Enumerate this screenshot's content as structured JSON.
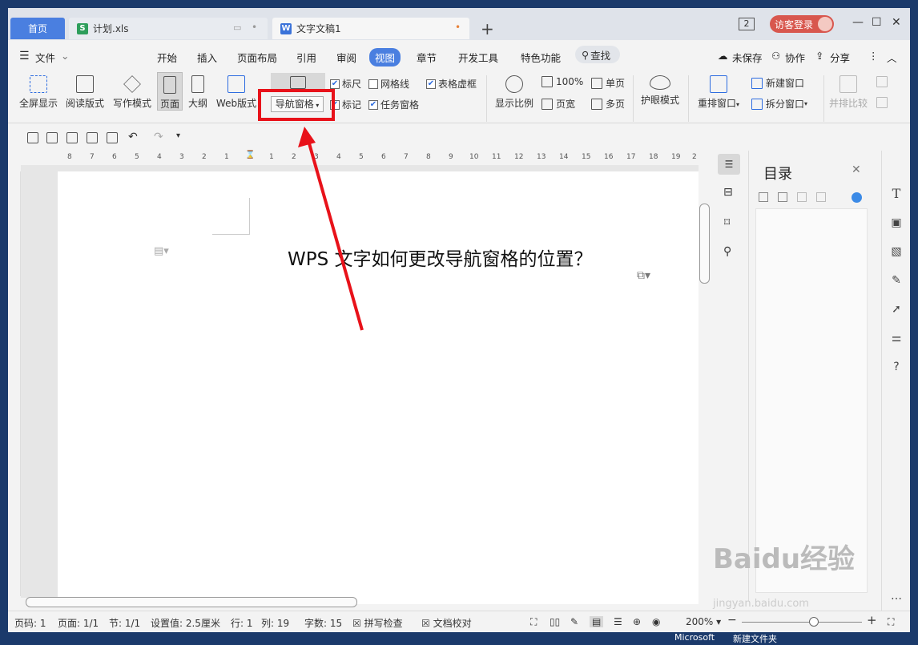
{
  "tabs": {
    "home": "首页",
    "xls": "计划.xls",
    "doc": "文字文稿1",
    "add": "+"
  },
  "header": {
    "count_badge": "2",
    "login": "访客登录",
    "minimize": "—",
    "maximize": "☐",
    "close": "✕"
  },
  "menubar": {
    "file": "文件",
    "items": [
      "开始",
      "插入",
      "页面布局",
      "引用",
      "审阅",
      "视图",
      "章节",
      "开发工具",
      "特色功能"
    ],
    "search": "查找",
    "unsaved": "未保存",
    "collab": "协作",
    "share": "分享"
  },
  "ribbon": {
    "fullscreen": "全屏显示",
    "read_mode": "阅读版式",
    "write_mode": "写作模式",
    "page": "页面",
    "outline": "大纲",
    "web": "Web版式",
    "nav_pane": "导航窗格",
    "ruler": "标尺",
    "gridlines": "网格线",
    "table_gridlines": "表格虚框",
    "marks": "标记",
    "task_pane": "任务窗格",
    "zoom_show": "显示比例",
    "zoom100": "100%",
    "page_width": "页宽",
    "single_page": "单页",
    "multi_page": "多页",
    "eye_mode": "护眼模式",
    "rearrange": "重排窗口",
    "new_window": "新建窗口",
    "split_window": "拆分窗口",
    "side_by_side": "并排比较"
  },
  "ruler_ticks": [
    "8",
    "7",
    "6",
    "5",
    "4",
    "3",
    "2",
    "1",
    "1",
    "2",
    "3",
    "4",
    "5",
    "6",
    "7",
    "8",
    "9",
    "10",
    "11",
    "12",
    "13",
    "14",
    "15",
    "16",
    "17",
    "18",
    "19",
    "2"
  ],
  "document": {
    "title": "WPS 文字如何更改导航窗格的位置？"
  },
  "nav_panel": {
    "title": "目录"
  },
  "status": {
    "page_code": "页码: 1",
    "pages": "页面: 1/1",
    "section": "节: 1/1",
    "setting": "设置值: 2.5厘米",
    "row": "行: 1",
    "col": "列: 19",
    "words": "字数: 15",
    "spell": "拼写检查",
    "proof": "文档校对",
    "zoom": "200%"
  },
  "taskbar": {
    "item1": "Microsoft",
    "item2": "新建文件夹"
  },
  "watermark": {
    "brand": "Baidu经验",
    "url": "jingyan.baidu.com"
  },
  "colors": {
    "accent": "#4a7fe0",
    "highlight": "#e8121a",
    "login": "#d8574e"
  }
}
